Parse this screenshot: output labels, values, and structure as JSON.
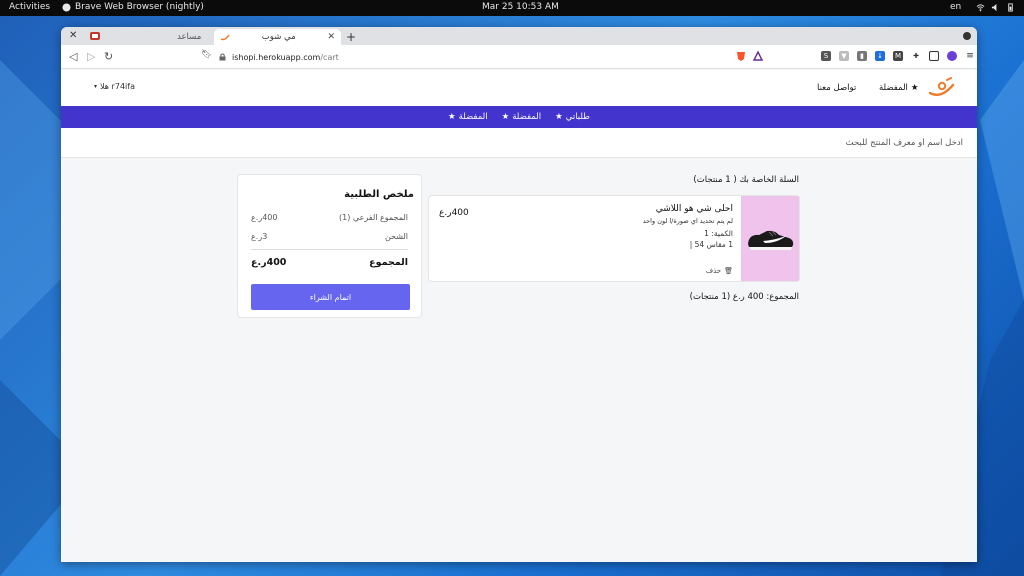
{
  "system": {
    "activities": "Activities",
    "app_name": "Brave Web Browser (nightly)",
    "clock": "Mar 25  10:53 AM",
    "lang": "en"
  },
  "browser": {
    "tabs": [
      {
        "label": "مساعد",
        "active": false
      },
      {
        "label": "مي شوب",
        "active": true
      }
    ],
    "url_domain": "ishopi.herokuapp.com",
    "url_path": "/cart"
  },
  "header": {
    "favorites": "المفضلة",
    "contact": "تواصل معنا",
    "user": "هلا r74ifa"
  },
  "nav": {
    "items": [
      "طلباتي",
      "المفضلة",
      "المفضلة"
    ]
  },
  "search": {
    "placeholder": "ادخل اسم او معرف المنتج للبحث"
  },
  "cart": {
    "title": "السلة الخاصة بك ( 1 منتجات)",
    "item": {
      "name": "احلى شي هو اللاشي",
      "note": "لم يتم تحديد اي صورة/ا لون واحد",
      "qty": "الكمية: 1",
      "size": "1 مقاس 54 |",
      "delete": "حذف",
      "price": "400ر.ع"
    },
    "total": "المجموع: 400 ر.ع (1 منتجات)"
  },
  "summary": {
    "title": "ملخص الطلبية",
    "subtotal_label": "المجموع الفرعي (1)",
    "subtotal_value": "400ر.ع",
    "shipping_label": "الشحن",
    "shipping_value": "3ر.ع",
    "total_label": "المجموع",
    "total_value": "400ر.ع",
    "checkout": "اتمام الشراء"
  },
  "colors": {
    "navbar": "#4234cc",
    "button": "#6565f0",
    "product_bg": "#efc3ec"
  }
}
